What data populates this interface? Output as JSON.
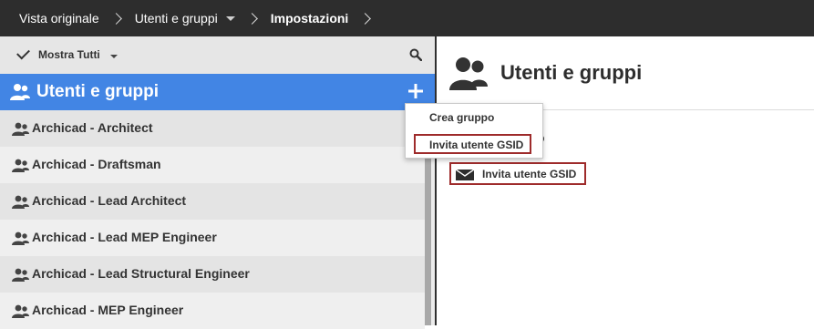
{
  "breadcrumb": {
    "items": [
      {
        "label": "Vista originale"
      },
      {
        "label": "Utenti e gruppi"
      },
      {
        "label": "Impostazioni"
      }
    ]
  },
  "filter": {
    "label": "Mostra Tutti"
  },
  "group_header": {
    "title": "Utenti e gruppi"
  },
  "groups": [
    {
      "label": "Archicad - Architect"
    },
    {
      "label": "Archicad - Draftsman"
    },
    {
      "label": "Archicad - Lead Architect"
    },
    {
      "label": "Archicad - Lead MEP Engineer"
    },
    {
      "label": "Archicad - Lead Structural Engineer"
    },
    {
      "label": "Archicad - MEP Engineer"
    }
  ],
  "main": {
    "title": "Utenti e gruppi",
    "partial_text": "o",
    "invite_button_label": "Invita utente GSID"
  },
  "menu": {
    "items": [
      {
        "label": "Crea gruppo"
      },
      {
        "label": "Invita utente GSID"
      }
    ]
  },
  "colors": {
    "topbar": "#2d2d2d",
    "accent": "#4285e4",
    "highlight_border": "#9e2b2b"
  }
}
